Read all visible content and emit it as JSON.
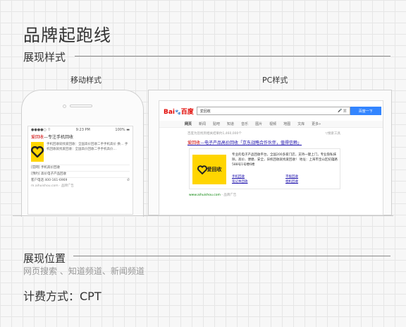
{
  "page": {
    "title": "品牌起跑线"
  },
  "display_style": {
    "heading": "展现样式",
    "mobile_label": "移动样式",
    "pc_label": "PC样式"
  },
  "mobile": {
    "carrier": "●●●●○ ⌔",
    "time": "9:23 PM",
    "battery": "100% ▬",
    "result_title_highlight": "爱回收",
    "result_title_rest": "—专注手机回收",
    "desc": "手机回收就找爱回收：全国高价回收二手手机高价 换… 手机回收就找爱回收：全国高价回收二手手机高价…",
    "row1": "[官网] 手机高价回收",
    "row2": "[预约] 高价电子产品回收",
    "phone_row": "客户电话 400-161-6969",
    "url": "m.aihuishou.com · 品牌广告"
  },
  "pc": {
    "logo_blue": "Bai",
    "logo_paw": "🐾",
    "logo_red": "百度",
    "query": "爱回收",
    "search_button": "百度一下",
    "tabs": [
      "网页",
      "新闻",
      "贴吧",
      "知道",
      "音乐",
      "图片",
      "视频",
      "地图",
      "文库",
      "更多»"
    ],
    "result_count": "百度为您找到相关结果约1,460,000个",
    "search_tools": "▽搜索工具",
    "title_highlight": "爱回收",
    "title_rest": "—电子产品高价回收「京东战略合作伙伴，值得信赖」",
    "logo_text": "爱回收",
    "desc": "专业的电子产品回收平台，全国200多家门店，支持一键上门，专业隐私抹除，高价、便捷、安全，旧机回收就找爱回收！ 地址：上海市宝山区纪蕴路588号1号楼6楼",
    "links": [
      "手机回收",
      "平板回收",
      "笔记本回收",
      "相机回收"
    ],
    "url": "www.aihuishou.com",
    "ad_tag": " - 品牌广告"
  },
  "position": {
    "heading": "展现位置",
    "channels": "网页搜索 、知道频道、新闻频道"
  },
  "billing": {
    "text": "计费方式：CPT"
  },
  "colors": {
    "accent_blue": "#3385ff",
    "brand_yellow": "#ffd500",
    "link_red": "#cc0000"
  }
}
